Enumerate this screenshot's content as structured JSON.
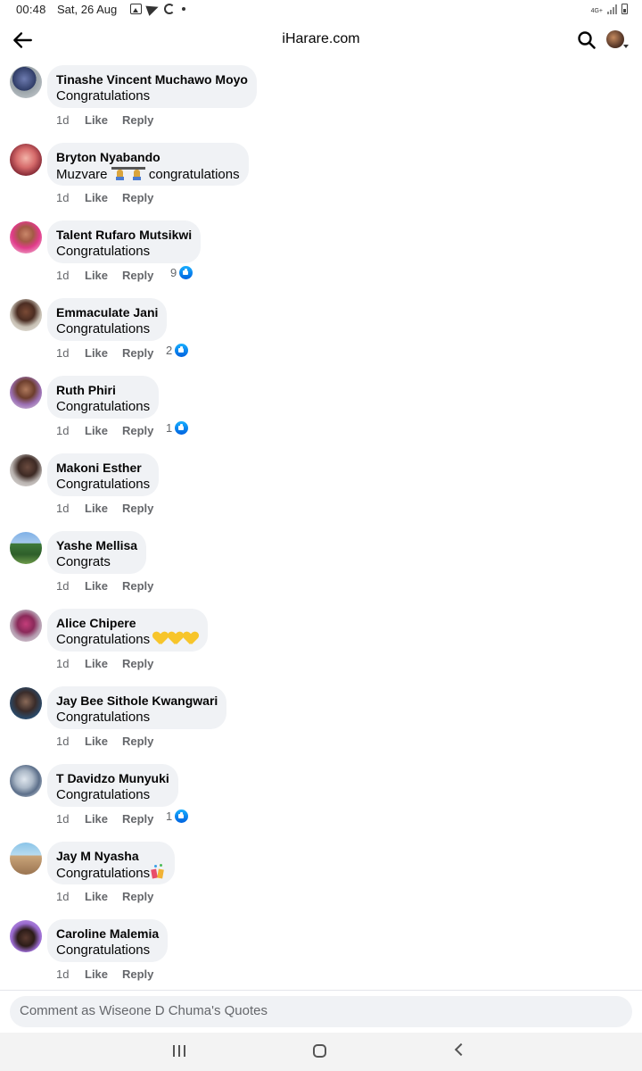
{
  "status_bar": {
    "time": "00:48",
    "date": "Sat, 26 Aug",
    "icons": [
      "gallery-icon",
      "telegram-icon",
      "sync-icon",
      "dot-icon"
    ],
    "network": "4G+",
    "right_icons": [
      "signal-icon",
      "battery-icon"
    ]
  },
  "header": {
    "title": "iHarare.com",
    "back_icon": "arrow-left-icon",
    "search_icon": "search-icon",
    "profile_icon": "profile-avatar"
  },
  "comments": [
    {
      "author": "Tinashe Vincent Muchawo Moyo",
      "text": "Congratulations",
      "emoji": "",
      "time": "1d",
      "like": "Like",
      "reply": "Reply",
      "reactions": ""
    },
    {
      "author": "Bryton Nyabando",
      "text_before": "Muzvare",
      "text_after": "congratulations",
      "emoji": "weightlifter-weightlifter",
      "time": "1d",
      "like": "Like",
      "reply": "Reply",
      "reactions": ""
    },
    {
      "author": "Talent Rufaro Mutsikwi",
      "text": "Congratulations",
      "emoji": "",
      "time": "1d",
      "like": "Like",
      "reply": "Reply",
      "reactions": "9"
    },
    {
      "author": "Emmaculate Jani",
      "text": "Congratulations",
      "emoji": "",
      "time": "1d",
      "like": "Like",
      "reply": "Reply",
      "reactions": "2"
    },
    {
      "author": "Ruth Phiri",
      "text": "Congratulations",
      "emoji": "",
      "time": "1d",
      "like": "Like",
      "reply": "Reply",
      "reactions": "1"
    },
    {
      "author": "Makoni Esther",
      "text": "Congratulations",
      "emoji": "",
      "time": "1d",
      "like": "Like",
      "reply": "Reply",
      "reactions": ""
    },
    {
      "author": "Yashe Mellisa",
      "text": "Congrats",
      "emoji": "",
      "time": "1d",
      "like": "Like",
      "reply": "Reply",
      "reactions": ""
    },
    {
      "author": "Alice Chipere",
      "text": "Congratulations",
      "emoji": "yellow-heart-x3",
      "time": "1d",
      "like": "Like",
      "reply": "Reply",
      "reactions": ""
    },
    {
      "author": "Jay Bee Sithole Kwangwari",
      "text": "Congratulations",
      "emoji": "",
      "time": "1d",
      "like": "Like",
      "reply": "Reply",
      "reactions": ""
    },
    {
      "author": "T Davidzo Munyuki",
      "text": "Congratulations",
      "emoji": "",
      "time": "1d",
      "like": "Like",
      "reply": "Reply",
      "reactions": "1"
    },
    {
      "author": "Jay M Nyasha",
      "text": "Congratulations",
      "emoji": "confetti",
      "time": "1d",
      "like": "Like",
      "reply": "Reply",
      "reactions": ""
    },
    {
      "author": "Caroline Malemia",
      "text": "Congratulations",
      "emoji": "",
      "time": "1d",
      "like": "Like",
      "reply": "Reply",
      "reactions": ""
    }
  ],
  "composer": {
    "placeholder": "Comment as Wiseone D Chuma's Quotes"
  },
  "nav_bar": {
    "icons": [
      "recent-apps-icon",
      "home-icon",
      "back-icon"
    ]
  },
  "colors": {
    "bubble_bg": "#f0f2f5",
    "secondary_text": "#65676b",
    "like_blue": "#0866ff",
    "heart_yellow": "#f7c52b"
  }
}
